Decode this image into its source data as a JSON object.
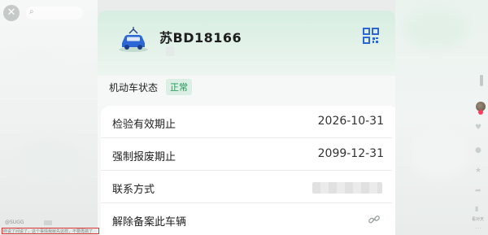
{
  "vehicle": {
    "plate": "苏BD18166",
    "status_label": "机动车状态",
    "status_value": "正常"
  },
  "rows": [
    {
      "label": "检验有效期止",
      "value": "2026-10-31"
    },
    {
      "label": "强制报废期止",
      "value": "2099-12-31"
    },
    {
      "label": "联系方式",
      "value": ""
    },
    {
      "label": "解除备案此车辆",
      "value": ""
    }
  ],
  "overlay": {
    "author": "@SUGG",
    "caption": "终说了间说了，这个事情我就先这样，不要再搞了",
    "side_label": "看对天"
  },
  "colors": {
    "accent_green": "#1c9a56",
    "brand_blue": "#2c67d6",
    "card_header": "#d7eee2"
  },
  "icons": [
    "car-icon",
    "qr-code-icon",
    "link-icon",
    "close-icon",
    "search-icon",
    "heart-icon",
    "comment-icon",
    "star-icon",
    "share-icon",
    "more-icon"
  ]
}
